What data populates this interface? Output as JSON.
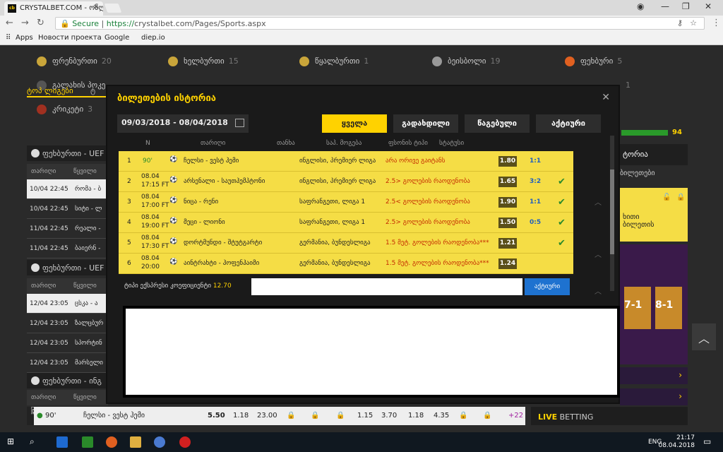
{
  "browser": {
    "tab_title": "CRYSTALBET.COM - ონლ",
    "favicon_text": "cb",
    "url_secure": "Secure",
    "url_protocol": "https://",
    "url_rest": "crystalbet.com/Pages/Sports.aspx",
    "bookmarks": [
      "Apps",
      "Новости проекта",
      "Google",
      "diep.io"
    ]
  },
  "sports": [
    {
      "name": "ფრენბურთი",
      "count": "20"
    },
    {
      "name": "ხელბურთი",
      "count": "15"
    },
    {
      "name": "წყალბურთი",
      "count": "1"
    },
    {
      "name": "ბეისბოლი",
      "count": "19"
    },
    {
      "name": "ფეხბური",
      "count": "5"
    },
    {
      "name": "გალახის პოკე",
      "count": ""
    },
    {
      "name": "კრიკეტი",
      "count": "3"
    },
    {
      "name": "",
      "count": "1"
    }
  ],
  "left": {
    "tab": "ტოპ ლიგები",
    "tab2": "ტ",
    "sections": [
      "ფეხბურთი - UEF",
      "ფეხბურთი - UEF",
      "ფეხბურთი - ინგ"
    ],
    "col_date": "თარიღი",
    "col_pair": "წყვილი",
    "rows1": [
      {
        "date": "10/04 22:45",
        "pair": "რომა - ბ"
      },
      {
        "date": "10/04 22:45",
        "pair": "სიტი - ლ"
      },
      {
        "date": "11/04 22:45",
        "pair": "რეალი - "
      },
      {
        "date": "11/04 22:45",
        "pair": "ბაიერნ - "
      }
    ],
    "rows2": [
      {
        "date": "12/04 23:05",
        "pair": "ცსკა - ა"
      },
      {
        "date": "12/04 23:05",
        "pair": "ზალცბურ"
      },
      {
        "date": "12/04 23:05",
        "pair": "სპორტინ"
      },
      {
        "date": "12/04 23:05",
        "pair": "მარსელი"
      }
    ]
  },
  "right": {
    "score": "94",
    "label1": "ტორია",
    "label2": "ბილეთები",
    "label3": "ხითი",
    "label4": "ბილეთის",
    "promo": [
      "7-1",
      "8-1"
    ]
  },
  "modal": {
    "title": "ბილეთების ისტორია",
    "date_range": "09/03/2018 - 08/04/2018",
    "filters": [
      "ყველა",
      "გადახდილი",
      "წაგებული",
      "აქტიური"
    ],
    "columns": [
      "N",
      "თარიღი",
      "თანხა",
      "საპ. მოგება",
      "ფსონის ტიპი",
      "სტატუსი"
    ],
    "rows": [
      {
        "n": "1",
        "date": "90'",
        "time": "",
        "match": "ჩელსი - ვესტ ჰემი",
        "league": "ინგლისი, პრემიერ ლიგა",
        "pick": "არა ორივე გაიტანს",
        "odd": "1.80",
        "score": "1:1",
        "won": ""
      },
      {
        "n": "2",
        "date": "08.04",
        "time": "17:15 FT",
        "match": "არსენალი - საუთჰემპტონი",
        "league": "ინგლისი, პრემიერ ლიგა",
        "pick": "2.5> გოლების რაოდენობა",
        "odd": "1.65",
        "score": "3:2",
        "won": "✔"
      },
      {
        "n": "3",
        "date": "08.04",
        "time": "17:00 FT",
        "match": "ნიცა - რენი",
        "league": "საფრანგეთი, ლიგა 1",
        "pick": "2.5< გოლების რაოდენობა",
        "odd": "1.90",
        "score": "1:1",
        "won": "✔"
      },
      {
        "n": "4",
        "date": "08.04",
        "time": "19:00 FT",
        "match": "მეცი - ლიონი",
        "league": "საფრანგეთი, ლიგა 1",
        "pick": "2.5> გოლების რაოდენობა",
        "odd": "1.50",
        "score": "0:5",
        "won": "✔"
      },
      {
        "n": "5",
        "date": "08.04",
        "time": "17:30 FT",
        "match": "დორტმუნდი - შტუტგარტი",
        "league": "გერმანია, ბუნდესლიგა",
        "pick": "1.5 მეტ. გოლების რაოდენობა***",
        "odd": "1.21",
        "score": "",
        "won": "✔"
      },
      {
        "n": "6",
        "date": "08.04",
        "time": "20:00",
        "match": "აინტრახტი - ჰოფენჰაიმი",
        "league": "გერმანია, ბუნდესლიგა",
        "pick": "1.5 მეტ. გოლების რაოდენობა***",
        "odd": "1.24",
        "score": "",
        "won": ""
      }
    ],
    "footer_type_label": "ტიპი",
    "footer_type": "ექსპრესი",
    "footer_coef_label": "კოეფიციენტი",
    "footer_coef": "12.70",
    "active_btn": "აქტიური"
  },
  "livebar": {
    "badge": "LIVE",
    "minute": "90'",
    "match": "ჩელსი - ვესტ ჰემი",
    "odds": [
      "5.50",
      "1.18",
      "23.00",
      "1.15",
      "3.70",
      "1.18",
      "4.35"
    ],
    "more": "+22"
  },
  "live_betting_left": "LIVE",
  "live_betting_right": " BETTING",
  "taskbar": {
    "lang": "ENG",
    "time": "21:17",
    "date": "08.04.2018"
  }
}
